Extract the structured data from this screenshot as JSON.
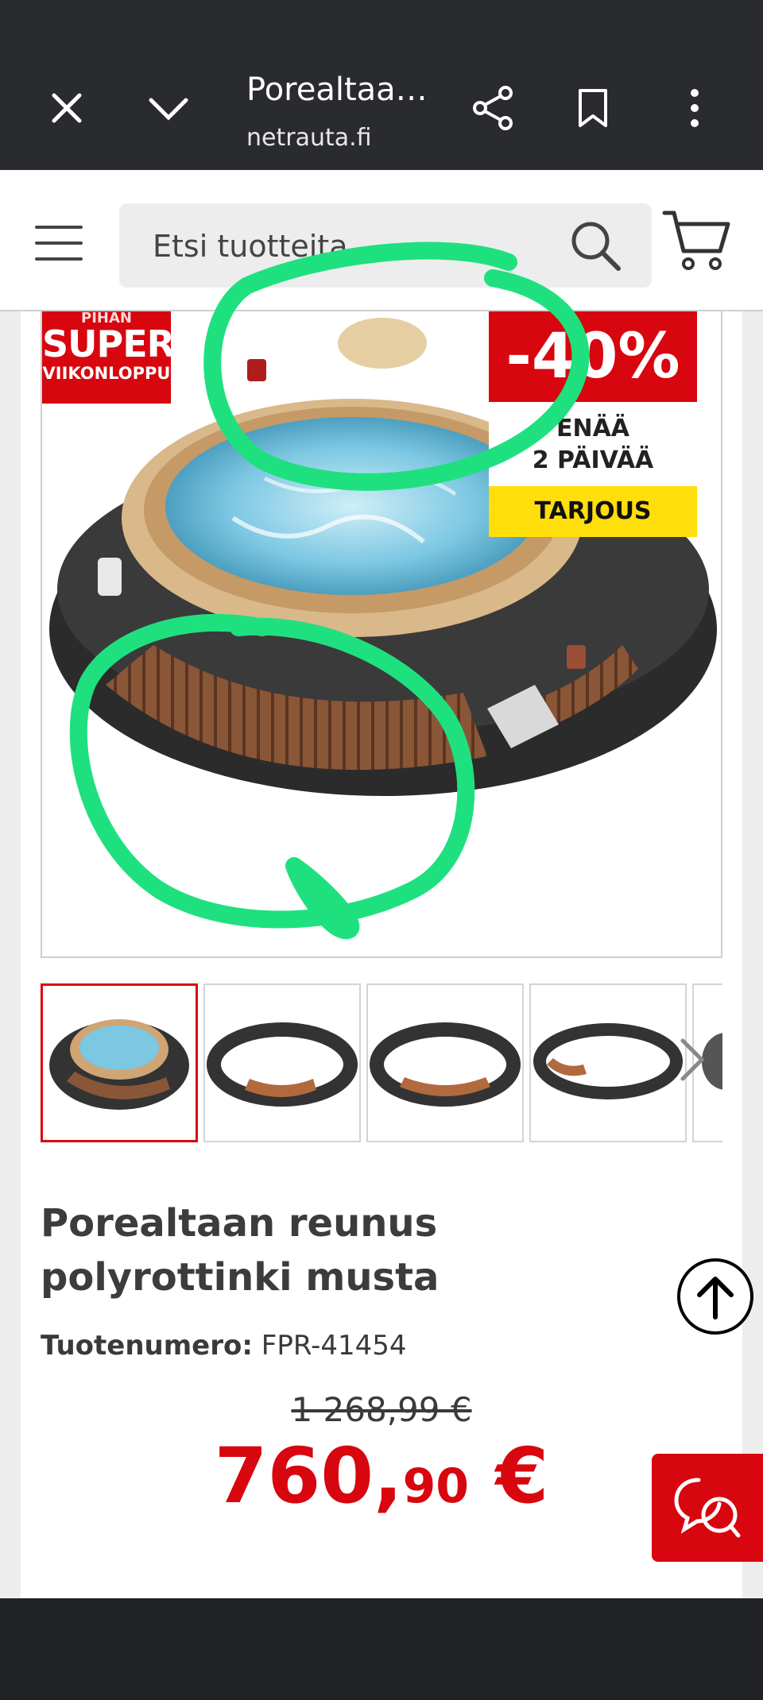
{
  "browser": {
    "title": "Porealtaa…",
    "url": "netrauta.fi"
  },
  "header": {
    "search_placeholder": "Etsi tuotteita"
  },
  "badges": {
    "super_line1": "PIHAN",
    "super_line2": "SUPER",
    "super_line3": "VIIKONLOPPU",
    "discount": "-40%",
    "days_line1": "ENÄÄ",
    "days_line2": "2 PÄIVÄÄ",
    "offer": "TARJOUS"
  },
  "product": {
    "title": "Porealtaan reunus polyrottinki musta",
    "sku_label": "Tuotenumero:",
    "sku_value": "FPR-41454",
    "old_price": "1 268,99 €",
    "price_int": "760,",
    "price_dec": "90",
    "price_currency": " €"
  },
  "colors": {
    "brand_red": "#d8060e",
    "offer_yellow": "#ffde0a",
    "annotation_green": "#1fe07f"
  }
}
